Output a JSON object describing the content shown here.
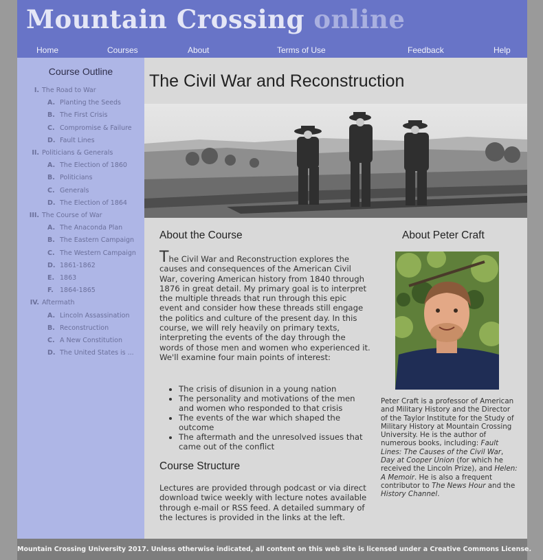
{
  "site": {
    "title_main": "Mountain Crossing",
    "title_suffix": "online"
  },
  "nav": {
    "items": [
      {
        "label": "Home"
      },
      {
        "label": "Courses"
      },
      {
        "label": "About"
      },
      {
        "label": "Terms of Use"
      },
      {
        "label": "Feedback"
      },
      {
        "label": "Help"
      }
    ]
  },
  "sidebar": {
    "title": "Course Outline",
    "items": [
      {
        "num": "I.",
        "label": "The Road to War",
        "level": 1
      },
      {
        "num": "A.",
        "label": "Planting the Seeds",
        "level": 2
      },
      {
        "num": "B.",
        "label": "The First Crisis",
        "level": 2
      },
      {
        "num": "C.",
        "label": "Compromise & Failure",
        "level": 2
      },
      {
        "num": "D.",
        "label": "Fault Lines",
        "level": 2
      },
      {
        "num": "II.",
        "label": "Politicians & Generals",
        "level": 1
      },
      {
        "num": "A.",
        "label": "The Election of 1860",
        "level": 2
      },
      {
        "num": "B.",
        "label": "Politicians",
        "level": 2
      },
      {
        "num": "C.",
        "label": "Generals",
        "level": 2
      },
      {
        "num": "D.",
        "label": "The Election of 1864",
        "level": 2
      },
      {
        "num": "III.",
        "label": "The Course of War",
        "level": 1
      },
      {
        "num": "A.",
        "label": "The Anaconda Plan",
        "level": 2
      },
      {
        "num": "B.",
        "label": "The Eastern Campaign",
        "level": 2
      },
      {
        "num": "C.",
        "label": "The Western Campaign",
        "level": 2
      },
      {
        "num": "D.",
        "label": "1861-1862",
        "level": 2
      },
      {
        "num": "E.",
        "label": "1863",
        "level": 2
      },
      {
        "num": "F.",
        "label": "1864-1865",
        "level": 2
      },
      {
        "num": "IV.",
        "label": "Aftermath",
        "level": 1
      },
      {
        "num": "A.",
        "label": "Lincoln Assassination",
        "level": 2
      },
      {
        "num": "B.",
        "label": "Reconstruction",
        "level": 2
      },
      {
        "num": "C.",
        "label": "A New Constitution",
        "level": 2
      },
      {
        "num": "D.",
        "label": "The United States is ...",
        "level": 2
      }
    ]
  },
  "main": {
    "course_title": "The Civil War and Reconstruction",
    "about_course": {
      "heading": "About the Course",
      "dropcap": "T",
      "intro": "he Civil War and Reconstruction explores the causes and consequences of the American Civil War, covering American history from 1840 through 1876 in great detail. My primary goal is to interpret the multiple threads that run through this epic event and consider how these threads still engage the politics and culture of the present day. In this course, we will rely heavily on primary texts, interpreting the events of the day through the words of those men and women who experienced it. We'll examine four main points of interest:",
      "points": [
        "The crisis of disunion in a young nation",
        "The personality and motivations of the men and women who responded to that crisis",
        "The events of the war which shaped the outcome",
        "The aftermath and the unresolved issues that came out of the conflict"
      ]
    },
    "course_structure": {
      "heading": "Course Structure",
      "text": "Lectures are provided through podcast or via direct download twice weekly with lecture notes available through e-mail or RSS feed. A detailed summary of the lectures is provided in the links at the left."
    },
    "about_instructor": {
      "heading": "About Peter Craft",
      "bio_1": "Peter Craft is a professor of American and Military History and the Director of the Taylor Institute for the Study of Military History at Mountain Crossing University. He is the author of numerous books, including: ",
      "book_1": "Fault Lines: The Causes of the Civil War",
      "bio_2": ", ",
      "book_2": "Day at Cooper Union",
      "bio_3": " (for which he received the Lincoln Prize), and ",
      "book_3": "Helen: A Memoir",
      "bio_4": ". He is also a frequent contributor to ",
      "show_1": "The News Hour",
      "bio_5": " and the ",
      "show_2": "History Channel",
      "bio_6": "."
    }
  },
  "footer": {
    "text": "Mountain Crossing University 2017. Unless otherwise indicated, all content on this web site is licensed under a Creative Commons License."
  },
  "colors": {
    "header": "#6874c7",
    "sidebar": "#aeb6e6",
    "content": "#d9d9d9",
    "footer": "#7d7d7d"
  }
}
